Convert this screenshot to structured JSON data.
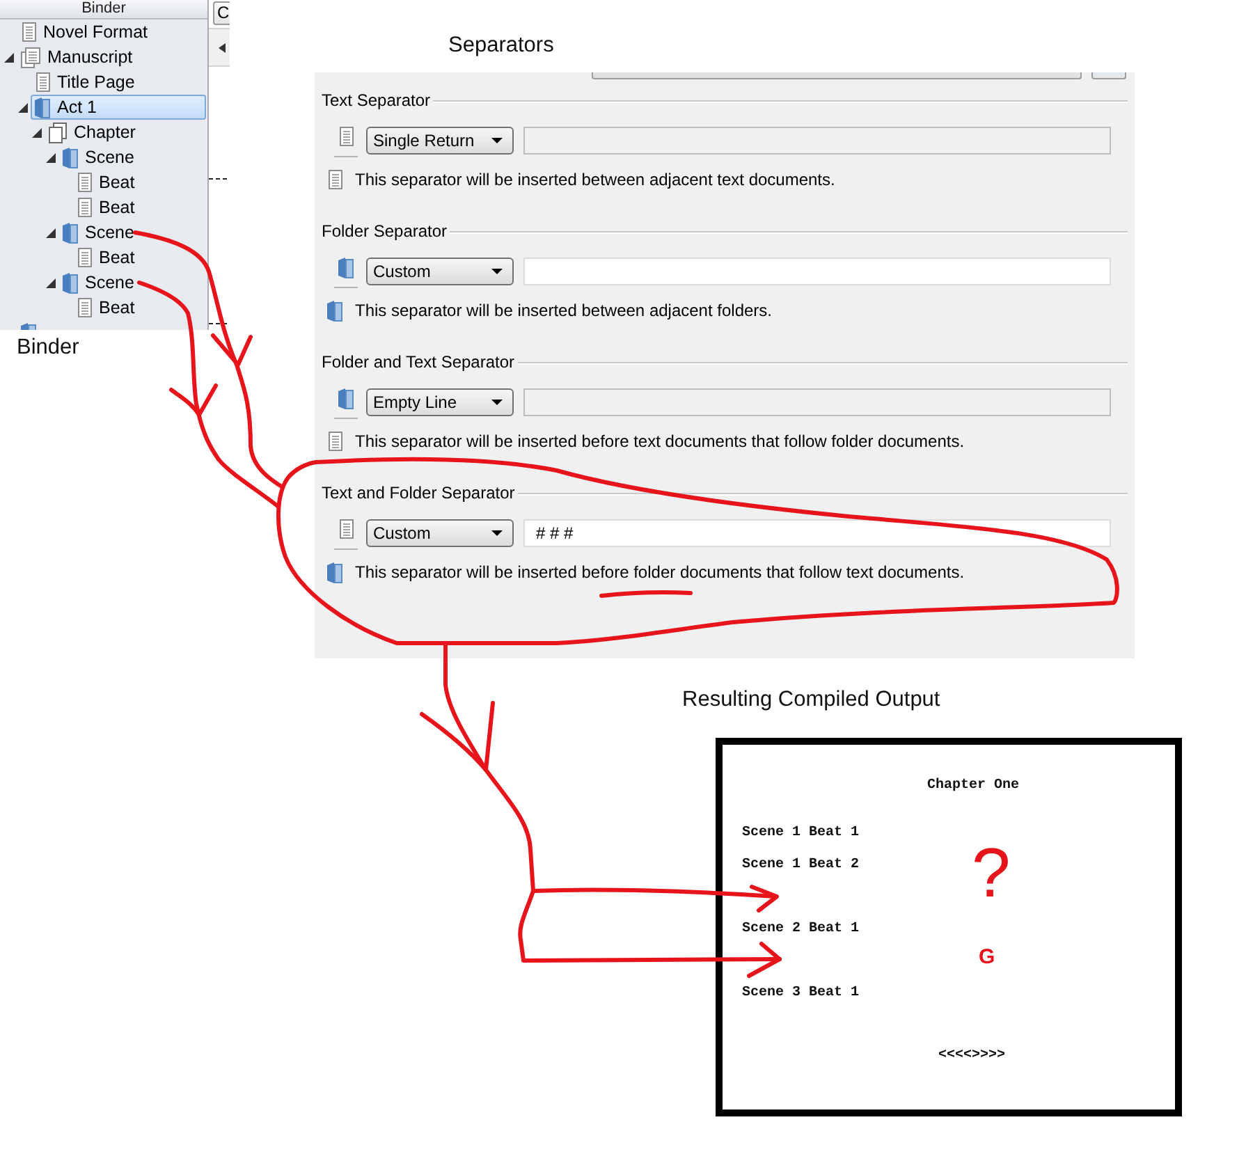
{
  "binder": {
    "header": "Binder",
    "items": [
      {
        "label": "Novel Format",
        "kind": "document",
        "selected": false
      },
      {
        "label": "Manuscript",
        "kind": "manuscript",
        "selected": false,
        "expanded": true,
        "children": [
          {
            "label": "Title Page",
            "kind": "document",
            "selected": false
          },
          {
            "label": "Act 1",
            "kind": "folder",
            "selected": true,
            "expanded": true,
            "children": [
              {
                "label": "Chapter",
                "kind": "chapter",
                "selected": false,
                "expanded": true,
                "children": [
                  {
                    "label": "Scene",
                    "kind": "folder",
                    "selected": false,
                    "expanded": true,
                    "children": [
                      {
                        "label": "Beat",
                        "kind": "document",
                        "selected": false
                      },
                      {
                        "label": "Beat",
                        "kind": "document",
                        "selected": false
                      }
                    ]
                  },
                  {
                    "label": "Scene",
                    "kind": "folder",
                    "selected": false,
                    "expanded": true,
                    "children": [
                      {
                        "label": "Beat",
                        "kind": "document",
                        "selected": false
                      }
                    ]
                  },
                  {
                    "label": "Scene",
                    "kind": "folder",
                    "selected": false,
                    "expanded": true,
                    "children": [
                      {
                        "label": "Beat",
                        "kind": "document",
                        "selected": false
                      }
                    ]
                  }
                ]
              }
            ]
          }
        ]
      },
      {
        "kind": "folder",
        "selected": false
      }
    ],
    "caption": "Binder"
  },
  "toolbar": {
    "button": "C"
  },
  "separators": {
    "caption": "Separators",
    "groups": [
      {
        "title": "Text Separator",
        "kind": "document",
        "choice": "Single Return",
        "field": {
          "enabled": false
        },
        "note": {
          "kind": "document",
          "text": "This separator will be inserted between adjacent text documents."
        }
      },
      {
        "title": "Folder Separator",
        "kind": "folder",
        "choice": "Custom",
        "field": {
          "enabled": true
        },
        "note": {
          "kind": "folder",
          "text": "This separator will be inserted between adjacent folders."
        }
      },
      {
        "title": "Folder and Text Separator",
        "kind": "folder",
        "choice": "Empty Line",
        "field": {
          "enabled": false
        },
        "note": {
          "kind": "document",
          "text": "This separator will be inserted before text documents that follow folder documents."
        }
      },
      {
        "title": "Text and Folder Separator",
        "kind": "document",
        "choice": "Custom",
        "field": {
          "enabled": true,
          "value": "# # #"
        },
        "note": {
          "kind": "folder",
          "text": "This separator will be inserted before folder documents that follow text documents."
        }
      }
    ]
  },
  "compiled_output": {
    "caption": "Resulting Compiled Output",
    "heading": "Chapter One",
    "scenes": [
      [
        "Scene 1 Beat 1",
        "Scene 1 Beat 2"
      ],
      [
        "Scene 2 Beat 1"
      ],
      [
        "Scene 3 Beat 1"
      ]
    ],
    "end_marker": "<<<<>>>>"
  },
  "annotations": {
    "question_mark": "?",
    "letter": "G"
  }
}
